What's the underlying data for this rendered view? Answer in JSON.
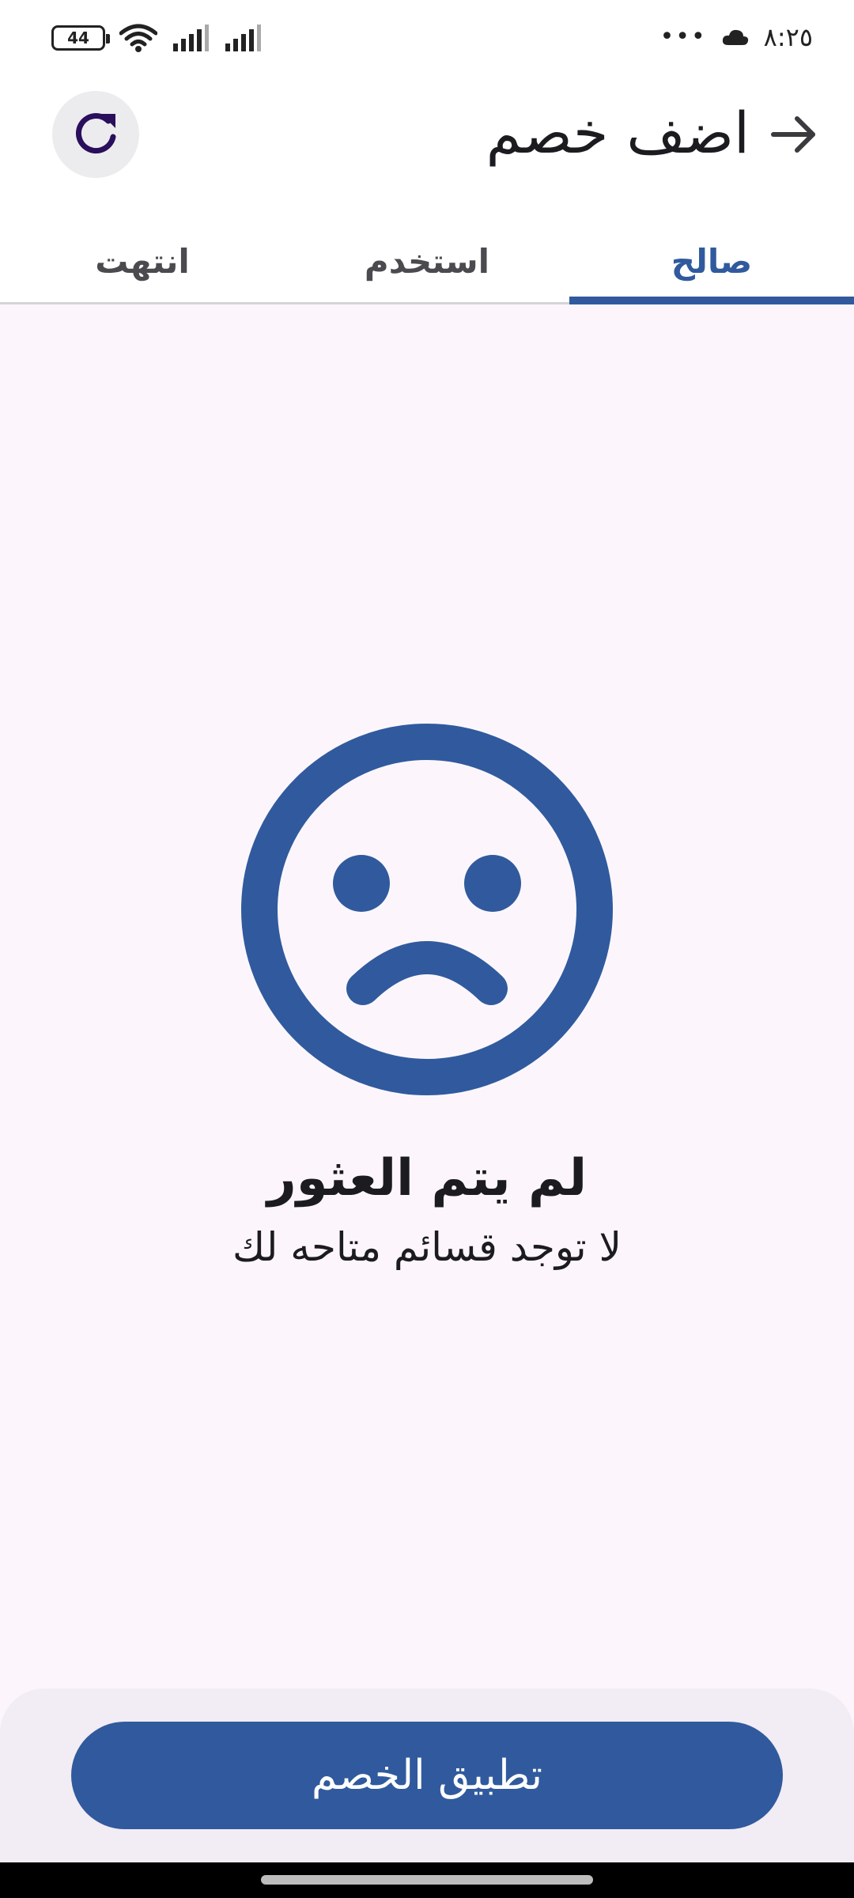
{
  "status_bar": {
    "time": "٨:٢٥",
    "battery_level": "44",
    "more_indicator": "•••",
    "icons": [
      "battery-icon",
      "wifi-icon",
      "signal-icon",
      "signal-icon",
      "cloud-icon"
    ]
  },
  "header": {
    "title": "اضف خصم",
    "back_icon": "arrow-right-icon",
    "refresh_icon": "refresh-icon"
  },
  "tabs": [
    {
      "label": "صالح",
      "active": true
    },
    {
      "label": "استخدم",
      "active": false
    },
    {
      "label": "انتهت",
      "active": false
    }
  ],
  "empty_state": {
    "icon": "sad-face-icon",
    "title": "لم يتم العثور",
    "subtitle": "لا توجد قسائم متاحه لك"
  },
  "footer": {
    "apply_label": "تطبيق الخصم"
  },
  "colors": {
    "primary": "#305a9d",
    "background": "#fcf6fc",
    "refresh_icon": "#2a0f5c"
  }
}
